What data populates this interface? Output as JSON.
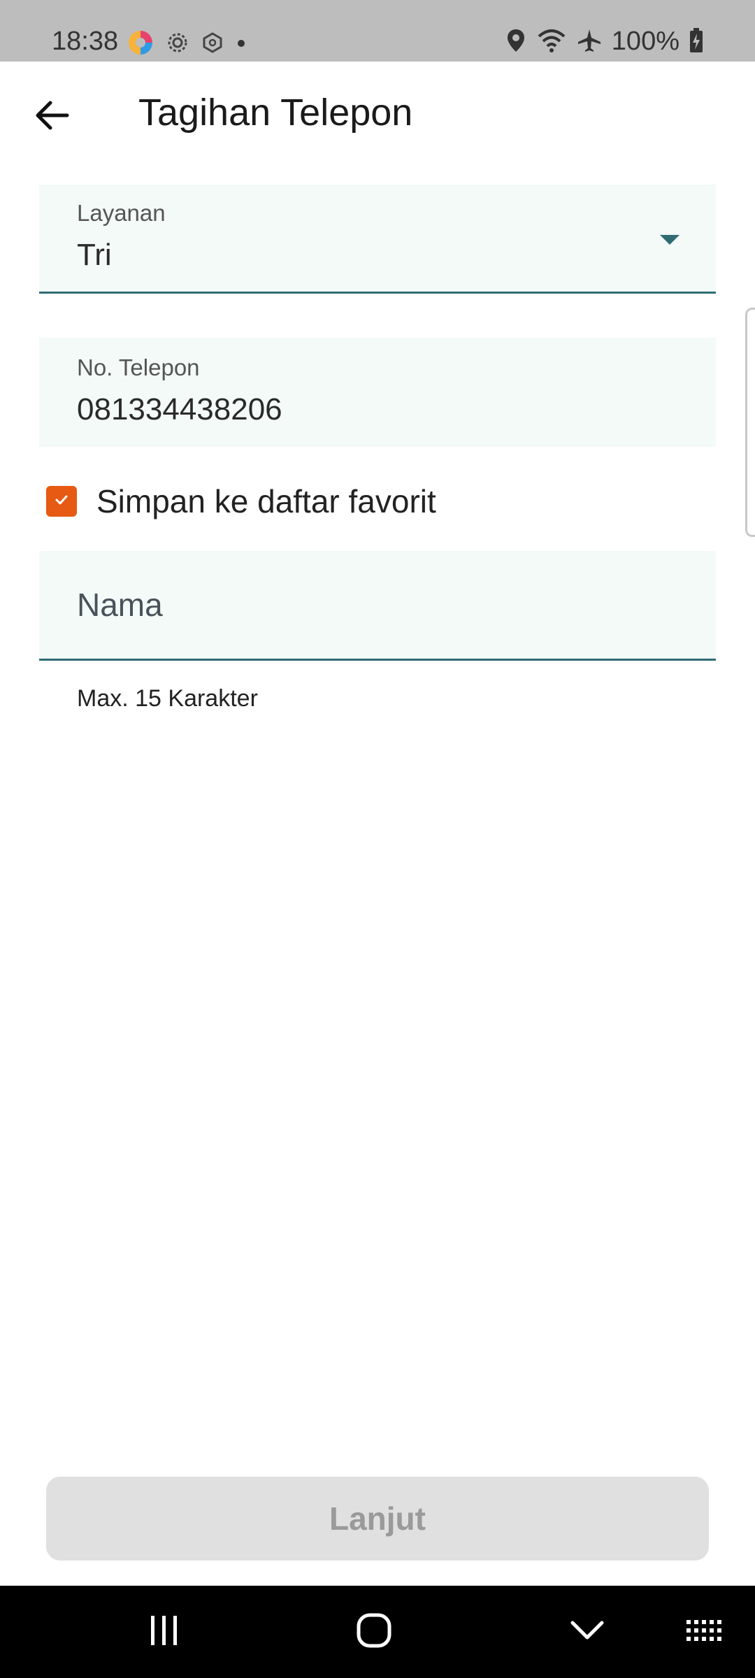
{
  "status_bar": {
    "time": "18:38",
    "battery": "100%",
    "icons": [
      "colorful-app-icon",
      "settings-gear-icon",
      "hexagon-icon",
      "dot-icon",
      "location-icon",
      "wifi-icon",
      "airplane-icon",
      "battery-charging-icon"
    ]
  },
  "app_bar": {
    "title": "Tagihan Telepon",
    "back_icon": "arrow-left-icon"
  },
  "form": {
    "service": {
      "label": "Layanan",
      "value": "Tri",
      "icon": "dropdown-arrow-icon"
    },
    "phone": {
      "label": "No. Telepon",
      "value": "081334438206"
    },
    "favorite": {
      "label": "Simpan ke daftar favorit",
      "checked": true,
      "color": "#e65a13"
    },
    "name": {
      "placeholder": "Nama",
      "helper": "Max. 15 Karakter"
    }
  },
  "primary_button": {
    "label": "Lanjut",
    "enabled": false
  },
  "nav_bar": {
    "items": [
      "recent-apps-icon",
      "home-icon",
      "back-chevron-icon",
      "keyboard-icon"
    ]
  },
  "colors": {
    "accent": "#2f6c74",
    "checkbox": "#e65a13",
    "field_bg": "#f3faf8"
  }
}
